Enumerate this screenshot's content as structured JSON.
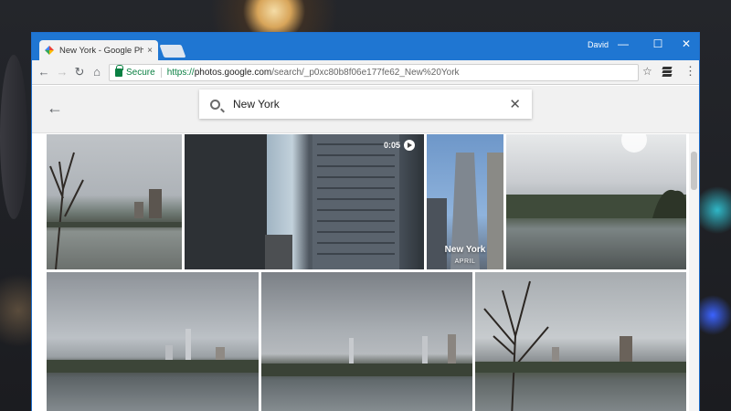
{
  "browser": {
    "tab_title": "New York - Google Photo",
    "tab_close": "×",
    "user": "David",
    "window_controls": {
      "minimize": "—",
      "maximize": "☐",
      "close": "✕"
    },
    "nav": {
      "back": "←",
      "forward": "→",
      "reload": "↻",
      "home": "⌂"
    },
    "omnibox": {
      "secure_label": "Secure",
      "url_scheme": "https://",
      "url_host": "photos.google.com",
      "url_path": "/search/_p0xc80b8f06e177fe62_New%20York"
    },
    "star": "☆",
    "menu": "⋮"
  },
  "app": {
    "back": "←",
    "search_value": "New York",
    "clear": "✕"
  },
  "photos": [
    {
      "label": "Central Park lake with bare tree"
    },
    {
      "label": "Skyscraper video",
      "duration": "0:05"
    },
    {
      "label": "Rockefeller tower",
      "title": "New York",
      "subtitle": "APRIL"
    },
    {
      "label": "Central Park lake reflection"
    },
    {
      "label": "Cloudy skyline over lake"
    },
    {
      "label": "Skyline over water"
    },
    {
      "label": "Tree over lake with skyline"
    }
  ]
}
